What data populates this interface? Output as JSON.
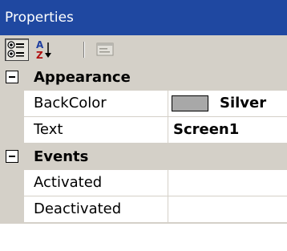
{
  "window": {
    "title": "Properties"
  },
  "toolbar": {
    "buttons": [
      {
        "icon": "categorized-icon",
        "pressed": true
      },
      {
        "icon": "alphabetical-sort-icon",
        "pressed": false
      },
      {
        "icon": "property-pages-icon",
        "pressed": false,
        "disabled": true
      }
    ],
    "alphabetical_glyph_top": "A",
    "alphabetical_glyph_bottom": "Z"
  },
  "categories": [
    {
      "label": "Appearance",
      "expanded": true,
      "expander_icon": "collapse-minus-icon",
      "properties": [
        {
          "name": "BackColor",
          "value": "Silver",
          "swatch_color": "#a8a8a8"
        },
        {
          "name": "Text",
          "value": "Screen1"
        }
      ]
    },
    {
      "label": "Events",
      "expanded": true,
      "expander_icon": "collapse-minus-icon",
      "properties": [
        {
          "name": "Activated",
          "value": ""
        },
        {
          "name": "Deactivated",
          "value": ""
        }
      ]
    }
  ],
  "colors": {
    "title_bar": "#1f48a1",
    "chrome": "#d4d0c8",
    "grid_line": "#d4d0c8"
  }
}
